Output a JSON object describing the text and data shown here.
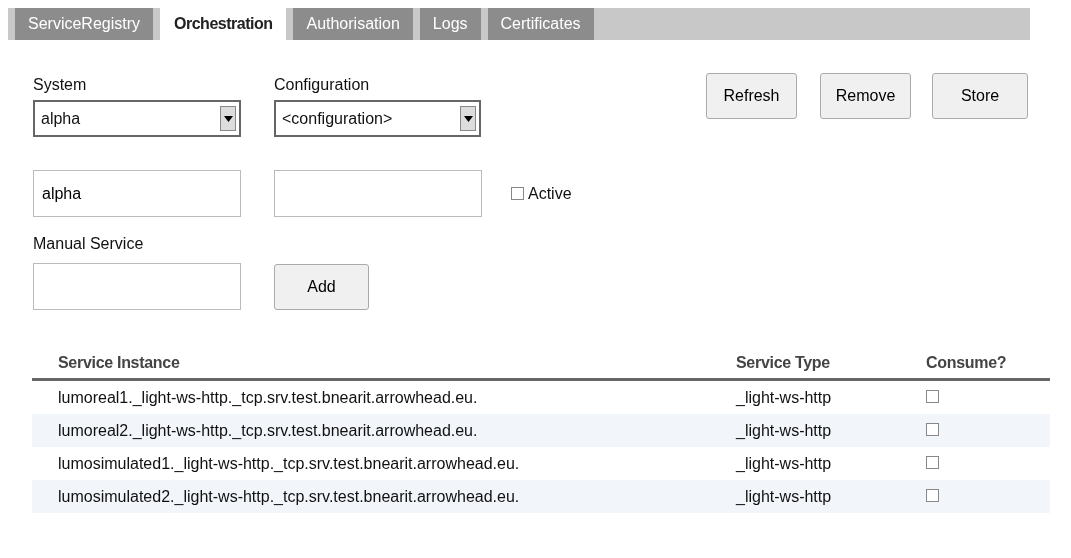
{
  "tabs": [
    {
      "label": "ServiceRegistry",
      "selected": false
    },
    {
      "label": "Orchestration",
      "selected": true
    },
    {
      "label": "Authorisation",
      "selected": false
    },
    {
      "label": "Logs",
      "selected": false
    },
    {
      "label": "Certificates",
      "selected": false
    }
  ],
  "system": {
    "label": "System",
    "value": "alpha",
    "input_value": "alpha"
  },
  "configuration": {
    "label": "Configuration",
    "value": "<configuration>"
  },
  "active": {
    "label": "Active",
    "checked": false
  },
  "buttons": [
    "Refresh",
    "Remove",
    "Store"
  ],
  "manual_service": {
    "label": "Manual Service",
    "button": "Add"
  },
  "table": {
    "columns": [
      "Service Instance",
      "Service Type",
      "Consume?"
    ],
    "rows": [
      {
        "instance": "lumoreal1._light-ws-http._tcp.srv.test.bnearit.arrowhead.eu.",
        "type": "_light-ws-http",
        "consume": false
      },
      {
        "instance": "lumoreal2._light-ws-http._tcp.srv.test.bnearit.arrowhead.eu.",
        "type": "_light-ws-http",
        "consume": false
      },
      {
        "instance": "lumosimulated1._light-ws-http._tcp.srv.test.bnearit.arrowhead.eu.",
        "type": "_light-ws-http",
        "consume": false
      },
      {
        "instance": "lumosimulated2._light-ws-http._tcp.srv.test.bnearit.arrowhead.eu.",
        "type": "_light-ws-http",
        "consume": false
      }
    ]
  }
}
